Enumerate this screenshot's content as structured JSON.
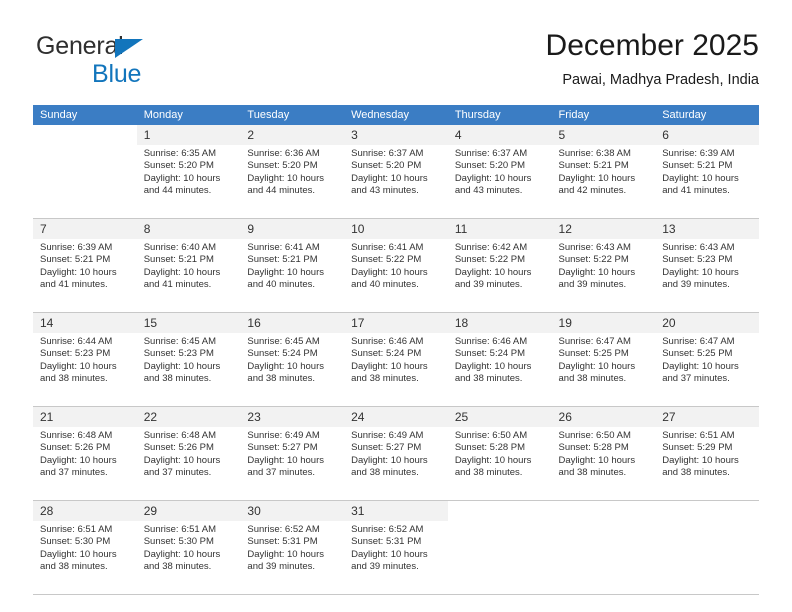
{
  "logo": {
    "word1": "General",
    "word2": "Blue",
    "triangle_icon": "triangle-icon",
    "color_dark": "#2f2f2f",
    "color_blue": "#1275bc"
  },
  "header": {
    "title": "December 2025",
    "subtitle": "Pawai, Madhya Pradesh, India"
  },
  "theme": {
    "header_bg": "#3b7dc4",
    "header_text": "#ffffff",
    "daynum_bg": "#f2f2f2",
    "cell_bg": "#ffffff",
    "grid_line": "#c8c8c8"
  },
  "weekdays": [
    "Sunday",
    "Monday",
    "Tuesday",
    "Wednesday",
    "Thursday",
    "Friday",
    "Saturday"
  ],
  "weeks": [
    [
      {
        "day": "",
        "lines": []
      },
      {
        "day": "1",
        "lines": [
          "Sunrise: 6:35 AM",
          "Sunset: 5:20 PM",
          "Daylight: 10 hours",
          "and 44 minutes."
        ]
      },
      {
        "day": "2",
        "lines": [
          "Sunrise: 6:36 AM",
          "Sunset: 5:20 PM",
          "Daylight: 10 hours",
          "and 44 minutes."
        ]
      },
      {
        "day": "3",
        "lines": [
          "Sunrise: 6:37 AM",
          "Sunset: 5:20 PM",
          "Daylight: 10 hours",
          "and 43 minutes."
        ]
      },
      {
        "day": "4",
        "lines": [
          "Sunrise: 6:37 AM",
          "Sunset: 5:20 PM",
          "Daylight: 10 hours",
          "and 43 minutes."
        ]
      },
      {
        "day": "5",
        "lines": [
          "Sunrise: 6:38 AM",
          "Sunset: 5:21 PM",
          "Daylight: 10 hours",
          "and 42 minutes."
        ]
      },
      {
        "day": "6",
        "lines": [
          "Sunrise: 6:39 AM",
          "Sunset: 5:21 PM",
          "Daylight: 10 hours",
          "and 41 minutes."
        ]
      }
    ],
    [
      {
        "day": "7",
        "lines": [
          "Sunrise: 6:39 AM",
          "Sunset: 5:21 PM",
          "Daylight: 10 hours",
          "and 41 minutes."
        ]
      },
      {
        "day": "8",
        "lines": [
          "Sunrise: 6:40 AM",
          "Sunset: 5:21 PM",
          "Daylight: 10 hours",
          "and 41 minutes."
        ]
      },
      {
        "day": "9",
        "lines": [
          "Sunrise: 6:41 AM",
          "Sunset: 5:21 PM",
          "Daylight: 10 hours",
          "and 40 minutes."
        ]
      },
      {
        "day": "10",
        "lines": [
          "Sunrise: 6:41 AM",
          "Sunset: 5:22 PM",
          "Daylight: 10 hours",
          "and 40 minutes."
        ]
      },
      {
        "day": "11",
        "lines": [
          "Sunrise: 6:42 AM",
          "Sunset: 5:22 PM",
          "Daylight: 10 hours",
          "and 39 minutes."
        ]
      },
      {
        "day": "12",
        "lines": [
          "Sunrise: 6:43 AM",
          "Sunset: 5:22 PM",
          "Daylight: 10 hours",
          "and 39 minutes."
        ]
      },
      {
        "day": "13",
        "lines": [
          "Sunrise: 6:43 AM",
          "Sunset: 5:23 PM",
          "Daylight: 10 hours",
          "and 39 minutes."
        ]
      }
    ],
    [
      {
        "day": "14",
        "lines": [
          "Sunrise: 6:44 AM",
          "Sunset: 5:23 PM",
          "Daylight: 10 hours",
          "and 38 minutes."
        ]
      },
      {
        "day": "15",
        "lines": [
          "Sunrise: 6:45 AM",
          "Sunset: 5:23 PM",
          "Daylight: 10 hours",
          "and 38 minutes."
        ]
      },
      {
        "day": "16",
        "lines": [
          "Sunrise: 6:45 AM",
          "Sunset: 5:24 PM",
          "Daylight: 10 hours",
          "and 38 minutes."
        ]
      },
      {
        "day": "17",
        "lines": [
          "Sunrise: 6:46 AM",
          "Sunset: 5:24 PM",
          "Daylight: 10 hours",
          "and 38 minutes."
        ]
      },
      {
        "day": "18",
        "lines": [
          "Sunrise: 6:46 AM",
          "Sunset: 5:24 PM",
          "Daylight: 10 hours",
          "and 38 minutes."
        ]
      },
      {
        "day": "19",
        "lines": [
          "Sunrise: 6:47 AM",
          "Sunset: 5:25 PM",
          "Daylight: 10 hours",
          "and 38 minutes."
        ]
      },
      {
        "day": "20",
        "lines": [
          "Sunrise: 6:47 AM",
          "Sunset: 5:25 PM",
          "Daylight: 10 hours",
          "and 37 minutes."
        ]
      }
    ],
    [
      {
        "day": "21",
        "lines": [
          "Sunrise: 6:48 AM",
          "Sunset: 5:26 PM",
          "Daylight: 10 hours",
          "and 37 minutes."
        ]
      },
      {
        "day": "22",
        "lines": [
          "Sunrise: 6:48 AM",
          "Sunset: 5:26 PM",
          "Daylight: 10 hours",
          "and 37 minutes."
        ]
      },
      {
        "day": "23",
        "lines": [
          "Sunrise: 6:49 AM",
          "Sunset: 5:27 PM",
          "Daylight: 10 hours",
          "and 37 minutes."
        ]
      },
      {
        "day": "24",
        "lines": [
          "Sunrise: 6:49 AM",
          "Sunset: 5:27 PM",
          "Daylight: 10 hours",
          "and 38 minutes."
        ]
      },
      {
        "day": "25",
        "lines": [
          "Sunrise: 6:50 AM",
          "Sunset: 5:28 PM",
          "Daylight: 10 hours",
          "and 38 minutes."
        ]
      },
      {
        "day": "26",
        "lines": [
          "Sunrise: 6:50 AM",
          "Sunset: 5:28 PM",
          "Daylight: 10 hours",
          "and 38 minutes."
        ]
      },
      {
        "day": "27",
        "lines": [
          "Sunrise: 6:51 AM",
          "Sunset: 5:29 PM",
          "Daylight: 10 hours",
          "and 38 minutes."
        ]
      }
    ],
    [
      {
        "day": "28",
        "lines": [
          "Sunrise: 6:51 AM",
          "Sunset: 5:30 PM",
          "Daylight: 10 hours",
          "and 38 minutes."
        ]
      },
      {
        "day": "29",
        "lines": [
          "Sunrise: 6:51 AM",
          "Sunset: 5:30 PM",
          "Daylight: 10 hours",
          "and 38 minutes."
        ]
      },
      {
        "day": "30",
        "lines": [
          "Sunrise: 6:52 AM",
          "Sunset: 5:31 PM",
          "Daylight: 10 hours",
          "and 39 minutes."
        ]
      },
      {
        "day": "31",
        "lines": [
          "Sunrise: 6:52 AM",
          "Sunset: 5:31 PM",
          "Daylight: 10 hours",
          "and 39 minutes."
        ]
      },
      {
        "day": "",
        "lines": []
      },
      {
        "day": "",
        "lines": []
      },
      {
        "day": "",
        "lines": []
      }
    ]
  ]
}
